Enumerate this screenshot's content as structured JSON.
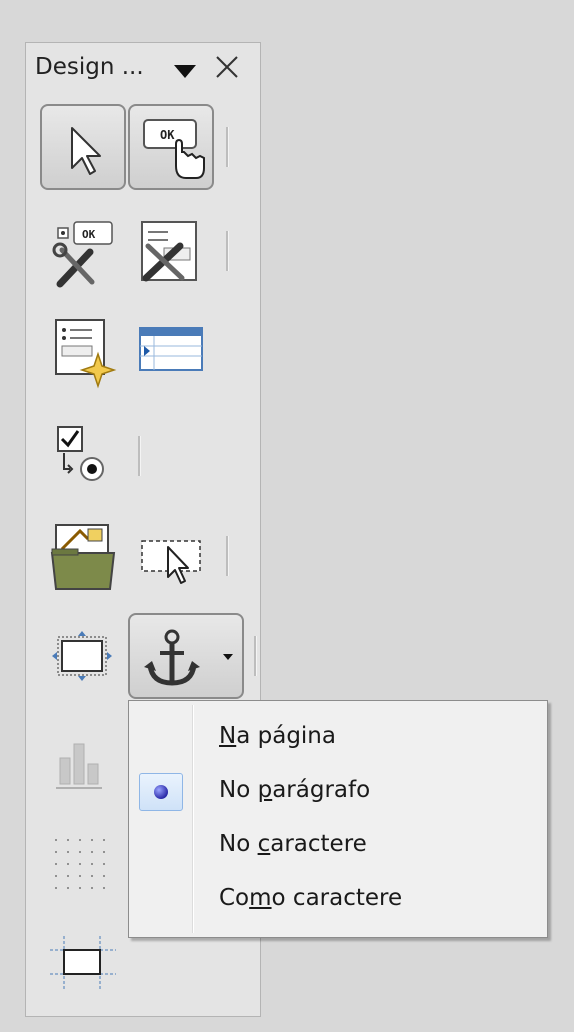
{
  "toolbar": {
    "title": "Design ...",
    "icons": [
      "select-arrow-icon",
      "design-mode-icon",
      "control-properties-icon",
      "form-properties-icon",
      "form-navigator-icon",
      "add-field-icon",
      "activation-order-icon",
      "open-in-design-mode-icon",
      "automatic-control-focus-icon",
      "position-and-size-icon",
      "anchor-icon",
      "align-icon",
      "display-grid-icon",
      "helplines-while-moving-icon"
    ]
  },
  "anchor_menu": {
    "items": [
      {
        "pre": "",
        "u": "N",
        "post": "a página",
        "checked": false
      },
      {
        "pre": "No ",
        "u": "p",
        "post": "arágrafo",
        "checked": true
      },
      {
        "pre": "No ",
        "u": "c",
        "post": "aractere",
        "checked": false
      },
      {
        "pre": "Co",
        "u": "m",
        "post": "o caractere",
        "checked": false
      }
    ]
  },
  "colors": {
    "background": "#d8d8d8",
    "toolbar": "#e4e4e4",
    "menu": "#f0f0f0",
    "radio_highlight": "#cfe2f8",
    "radio_dot": "#2a2aa8"
  }
}
